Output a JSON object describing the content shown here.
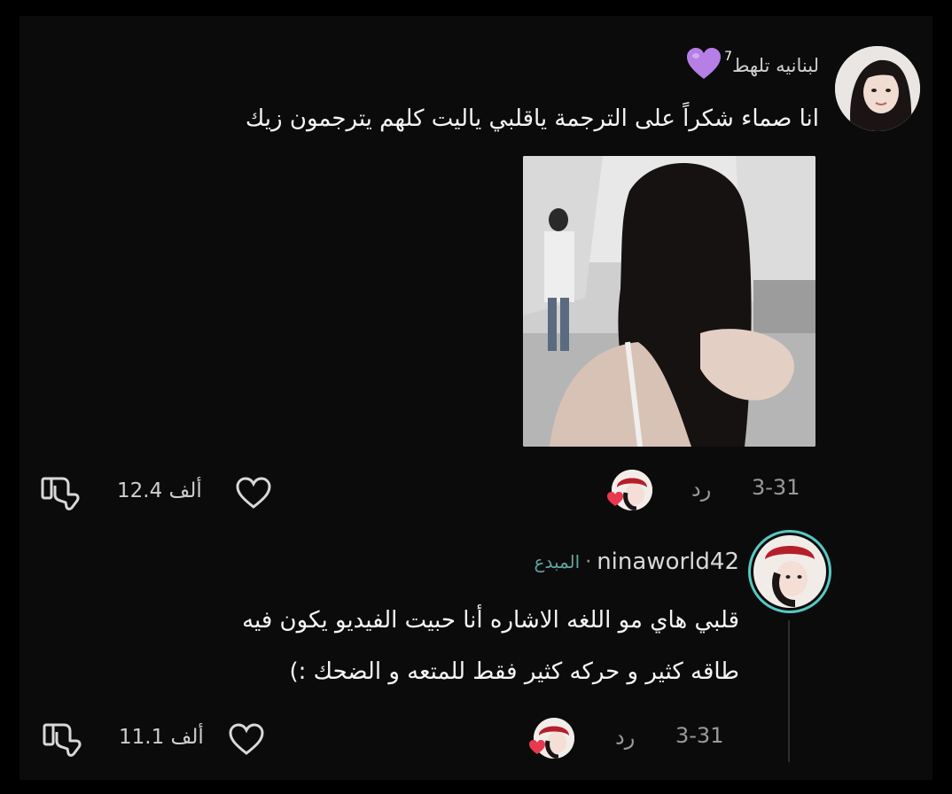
{
  "comment": {
    "username": "لبنانيه تلهط",
    "superscript": "7",
    "text": "انا صماء شكراً على الترجمة ياقلبي ياليت كلهم يترجمون زيك",
    "date": "3-31",
    "reply_label": "رد",
    "likes": "12.4 ألف"
  },
  "reply": {
    "username": "ninaworld42",
    "separator": "·",
    "creator_badge": "المبدع",
    "text_line1": "قلبي هاي مو اللغه الاشاره أنا حبيت الفيديو يكون فيه",
    "text_line2": "طاقه كثير و حركه كثير فقط للمتعه و الضحك :)",
    "date": "3-31",
    "reply_label": "رد",
    "likes": "11.1 ألف"
  },
  "colors": {
    "background": "#0b0b0c",
    "heart_emoji": "#b57fe6",
    "creator_badge": "#5fa6a0",
    "avatar_ring": "#57c9c2"
  }
}
